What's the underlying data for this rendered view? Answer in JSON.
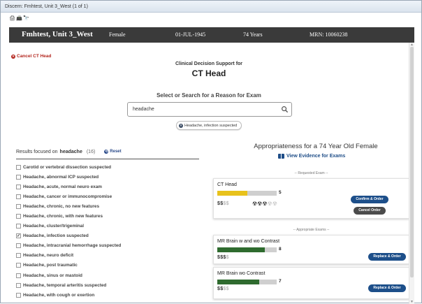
{
  "window": {
    "title": "Discern: Fmhtest, Unit 3_West (1 of 1)"
  },
  "toolbar": {
    "icons": [
      "print-icon",
      "printer-icon",
      "binoculars-icon"
    ],
    "glyphs": [
      "🖨",
      "📠",
      "🔭"
    ]
  },
  "patient": {
    "name": "Fmhtest, Unit 3_West",
    "sex": "Female",
    "dob": "01-JUL-1945",
    "age": "74 Years",
    "mrn": "MRN: 10060238"
  },
  "cancel_label": "Cancel CT Head",
  "header": {
    "label": "Clinical Decision Support for",
    "exam_title": "CT Head"
  },
  "search": {
    "label": "Select or Search for a Reason for Exam",
    "value": "headache"
  },
  "selected_chip": "Headache, infection suspected",
  "results": {
    "prefix": "Results focused on",
    "term": "headache",
    "count": "(16)",
    "reset_label": "Reset",
    "items": [
      {
        "label": "Carotid or vertebral dissection suspected",
        "checked": false
      },
      {
        "label": "Headache, abnormal ICP suspected",
        "checked": false
      },
      {
        "label": "Headache, acute, normal neuro exam",
        "checked": false
      },
      {
        "label": "Headache, cancer or immunocompromise",
        "checked": false
      },
      {
        "label": "Headache, chronic, no new features",
        "checked": false
      },
      {
        "label": "Headache, chronic, with new features",
        "checked": false
      },
      {
        "label": "Headache, cluster/trigeminal",
        "checked": false
      },
      {
        "label": "Headache, infection suspected",
        "checked": true
      },
      {
        "label": "Headache, intracranial hemorrhage suspected",
        "checked": false
      },
      {
        "label": "Headache, neuro deficit",
        "checked": false
      },
      {
        "label": "Headache, post traumatic",
        "checked": false
      },
      {
        "label": "Headache, sinus or mastoid",
        "checked": false
      },
      {
        "label": "Headache, temporal arteritis suspected",
        "checked": false
      },
      {
        "label": "Headache, with cough or exertion",
        "checked": false
      }
    ]
  },
  "appropriateness": {
    "title": "Appropriateness for a 74 Year Old Female",
    "evidence_label": "View Evidence for Exams",
    "requested_label": "-- Requested Exam --",
    "appropriate_label": "-- Appropriate Exams --"
  },
  "requested_exam": {
    "name": "CT Head",
    "score": "5",
    "score_fraction": 0.5,
    "bar_color": "#e8c21c",
    "cost_on": "$$",
    "cost_off": "$$",
    "radiation_on": "☢☢☢",
    "radiation_off": "☢☢",
    "confirm_label": "Confirm & Order",
    "cancel_label": "Cancel Order"
  },
  "appropriate_exams": [
    {
      "name": "MR Brain w and wo Contrast",
      "score": "8",
      "score_fraction": 0.8,
      "bar_color": "#2f6b2f",
      "cost_on": "$$$",
      "cost_off": "$",
      "button_label": "Replace & Order"
    },
    {
      "name": "MR Brain wo Contrast",
      "score": "7",
      "score_fraction": 0.7,
      "bar_color": "#2f6b2f",
      "cost_on": "$$",
      "cost_off": "$$",
      "button_label": "Replace & Order"
    }
  ]
}
